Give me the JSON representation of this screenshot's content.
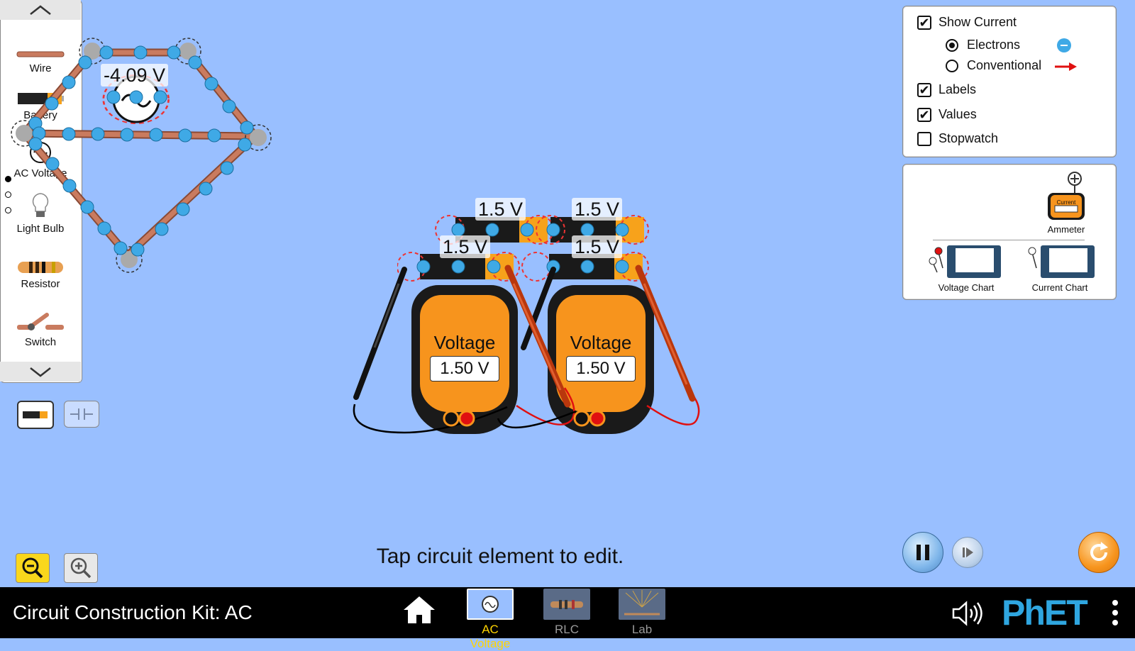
{
  "toolbox": {
    "items": [
      {
        "label": "Wire",
        "icon": "wire-icon"
      },
      {
        "label": "Battery",
        "icon": "battery-icon"
      },
      {
        "label": "AC Voltage",
        "icon": "ac-source-icon"
      },
      {
        "label": "Light Bulb",
        "icon": "light-bulb-icon"
      },
      {
        "label": "Resistor",
        "icon": "resistor-icon"
      },
      {
        "label": "Switch",
        "icon": "switch-icon"
      }
    ]
  },
  "circuit": {
    "ac_source_value": "-4.09 V",
    "battery_labels": [
      "1.5 V",
      "1.5 V",
      "1.5 V",
      "1.5 V"
    ]
  },
  "meters": [
    {
      "title": "Voltage",
      "value": "1.50 V"
    },
    {
      "title": "Voltage",
      "value": "1.50 V"
    }
  ],
  "display_panel": {
    "show_current": "Show Current",
    "electrons": "Electrons",
    "conventional": "Conventional",
    "labels": "Labels",
    "values": "Values",
    "stopwatch": "Stopwatch",
    "show_current_checked": true,
    "electrons_selected": true,
    "labels_checked": true,
    "values_checked": true,
    "stopwatch_checked": false
  },
  "sensor_panel": {
    "ammeter": "Ammeter",
    "ammeter_face": "Current",
    "voltage_chart": "Voltage Chart",
    "current_chart": "Current Chart"
  },
  "status_text": "Tap circuit element to edit.",
  "navbar": {
    "title": "Circuit Construction Kit: AC",
    "screens": [
      {
        "label": "AC Voltage",
        "active": true
      },
      {
        "label": "RLC",
        "active": false
      },
      {
        "label": "Lab",
        "active": false
      }
    ],
    "brand": "PhET"
  },
  "colors": {
    "background": "#99bfff",
    "electron": "#3fa9e6",
    "wire": "#b5654a",
    "meter_orange": "#f7941d",
    "active_screen": "#ffd400",
    "phet_blue": "#2fa6e0"
  }
}
